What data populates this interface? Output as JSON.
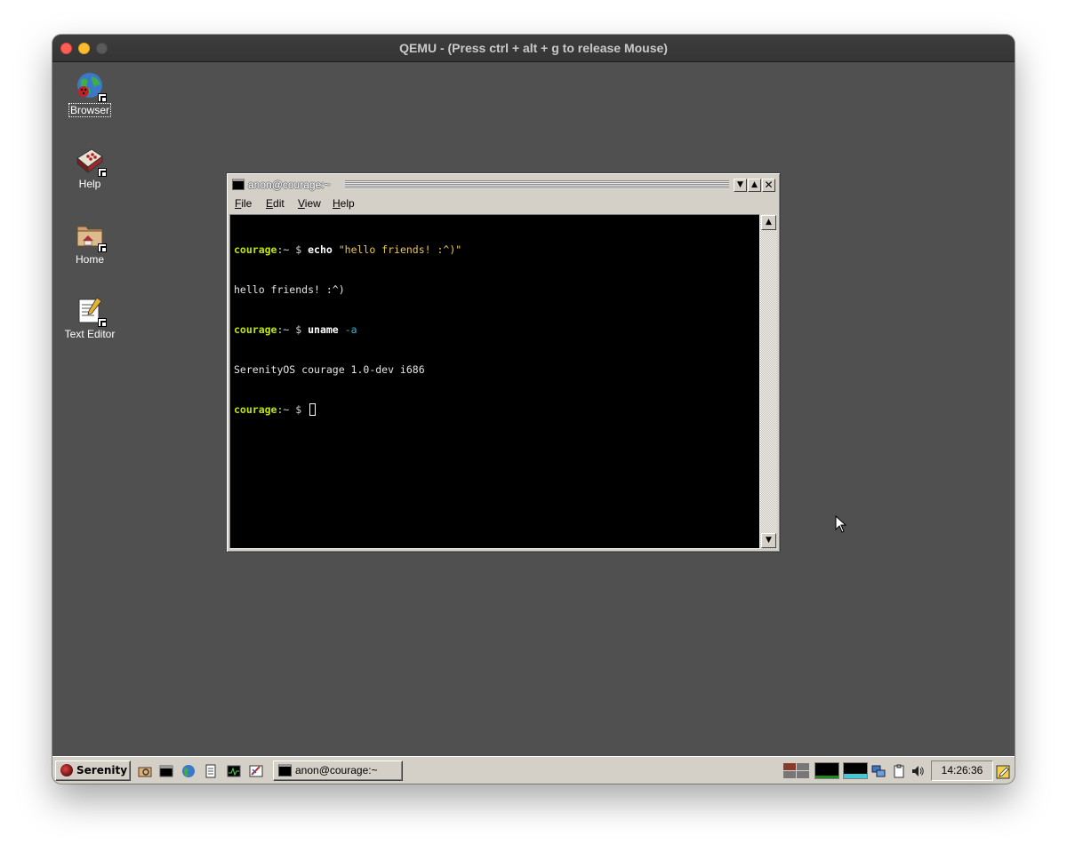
{
  "host_window": {
    "title": "QEMU - (Press ctrl + alt + g to release Mouse)"
  },
  "desktop": {
    "icons": [
      {
        "label": "Browser",
        "icon": "browser-globe-icon",
        "selected": true
      },
      {
        "label": "Help",
        "icon": "help-book-icon"
      },
      {
        "label": "Home",
        "icon": "home-folder-icon"
      },
      {
        "label": "Text Editor",
        "icon": "text-editor-icon"
      }
    ]
  },
  "terminal": {
    "title": "anon@courage:~",
    "menu": {
      "file_u": "F",
      "file_rest": "ile",
      "edit_u": "E",
      "edit_rest": "dit",
      "view_u": "V",
      "view_rest": "iew",
      "help_u": "H",
      "help_rest": "elp"
    },
    "lines": {
      "l1_host": "courage",
      "l1_rest": ":~ $ ",
      "l1_cmd": "echo",
      "l1_arg": " \"hello friends! :^)\"",
      "l2_out": "hello friends! :^)",
      "l3_host": "courage",
      "l3_rest": ":~ $ ",
      "l3_cmd": "uname",
      "l3_arg": " -a",
      "l4_out": "SerenityOS courage 1.0-dev i686",
      "l5_host": "courage",
      "l5_rest": ":~ $ "
    }
  },
  "taskbar": {
    "start_label": "Serenity",
    "task_label": "anon@courage:~",
    "clock": "14:26:36"
  },
  "colors": {
    "desktop_bg": "#505050",
    "window_chrome": "#d4d0c8",
    "prompt_host": "#bfe600",
    "string_literal": "#e8c85a",
    "flag": "#38b6c4"
  }
}
